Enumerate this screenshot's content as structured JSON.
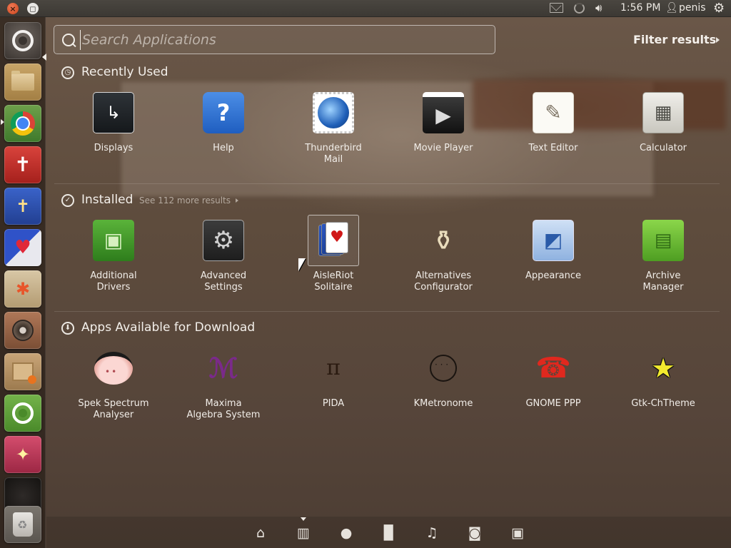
{
  "top_panel": {
    "clock": "1:56 PM",
    "user": "penis",
    "icons": [
      "close-icon",
      "maximize-icon",
      "mail-icon",
      "network-icon",
      "volume-icon",
      "user-icon",
      "gear-icon"
    ]
  },
  "launcher": {
    "items": [
      {
        "name": "dash-home",
        "icon": "ubuntu-logo"
      },
      {
        "name": "files",
        "icon": "folder-icon"
      },
      {
        "name": "chrome",
        "icon": "chrome-icon"
      },
      {
        "name": "bible-app",
        "icon": "bible-icon"
      },
      {
        "name": "bible-study-app",
        "icon": "bible-book-icon"
      },
      {
        "name": "bible-heart-app",
        "icon": "cross-heart-icon"
      },
      {
        "name": "paint-app",
        "icon": "paint-icon"
      },
      {
        "name": "sound-app",
        "icon": "speaker-icon"
      },
      {
        "name": "archive-app",
        "icon": "box-icon"
      },
      {
        "name": "ubuntu-one",
        "icon": "ubuntu-one-icon"
      },
      {
        "name": "tweak-app",
        "icon": "wand-icon"
      },
      {
        "name": "workspace-switcher",
        "icon": "workspaces-icon"
      },
      {
        "name": "trash",
        "icon": "trash-icon"
      }
    ]
  },
  "search": {
    "placeholder": "Search Applications",
    "value": ""
  },
  "filter": {
    "label": "Filter results"
  },
  "categories": {
    "recent": {
      "title": "Recently Used",
      "apps": [
        {
          "line1": "Displays",
          "line2": ""
        },
        {
          "line1": "Help",
          "line2": ""
        },
        {
          "line1": "Thunderbird",
          "line2": "Mail"
        },
        {
          "line1": "Movie Player",
          "line2": ""
        },
        {
          "line1": "Text Editor",
          "line2": ""
        },
        {
          "line1": "Calculator",
          "line2": ""
        }
      ]
    },
    "installed": {
      "title": "Installed",
      "see_more": "See 112 more results",
      "apps": [
        {
          "line1": "Additional",
          "line2": "Drivers"
        },
        {
          "line1": "Advanced",
          "line2": "Settings"
        },
        {
          "line1": "AisleRiot",
          "line2": "Solitaire"
        },
        {
          "line1": "Alternatives",
          "line2": "Configurator"
        },
        {
          "line1": "Appearance",
          "line2": ""
        },
        {
          "line1": "Archive",
          "line2": "Manager"
        }
      ]
    },
    "download": {
      "title": "Apps Available for Download",
      "apps": [
        {
          "line1": "Spek Spectrum",
          "line2": "Analyser"
        },
        {
          "line1": "Maxima",
          "line2": "Algebra System"
        },
        {
          "line1": "PIDA",
          "line2": ""
        },
        {
          "line1": "KMetronome",
          "line2": ""
        },
        {
          "line1": "GNOME PPP",
          "line2": ""
        },
        {
          "line1": "Gtk-ChTheme",
          "line2": ""
        }
      ]
    }
  },
  "lenses": [
    {
      "name": "home",
      "icon": "home-icon"
    },
    {
      "name": "applications",
      "icon": "applications-icon",
      "active": true
    },
    {
      "name": "software-center",
      "icon": "software-icon"
    },
    {
      "name": "files",
      "icon": "file-icon"
    },
    {
      "name": "music",
      "icon": "music-icon"
    },
    {
      "name": "photos",
      "icon": "camera-icon"
    },
    {
      "name": "video",
      "icon": "video-icon"
    }
  ],
  "colors": {
    "accent": "#e05a20",
    "text": "#f2ede8"
  }
}
